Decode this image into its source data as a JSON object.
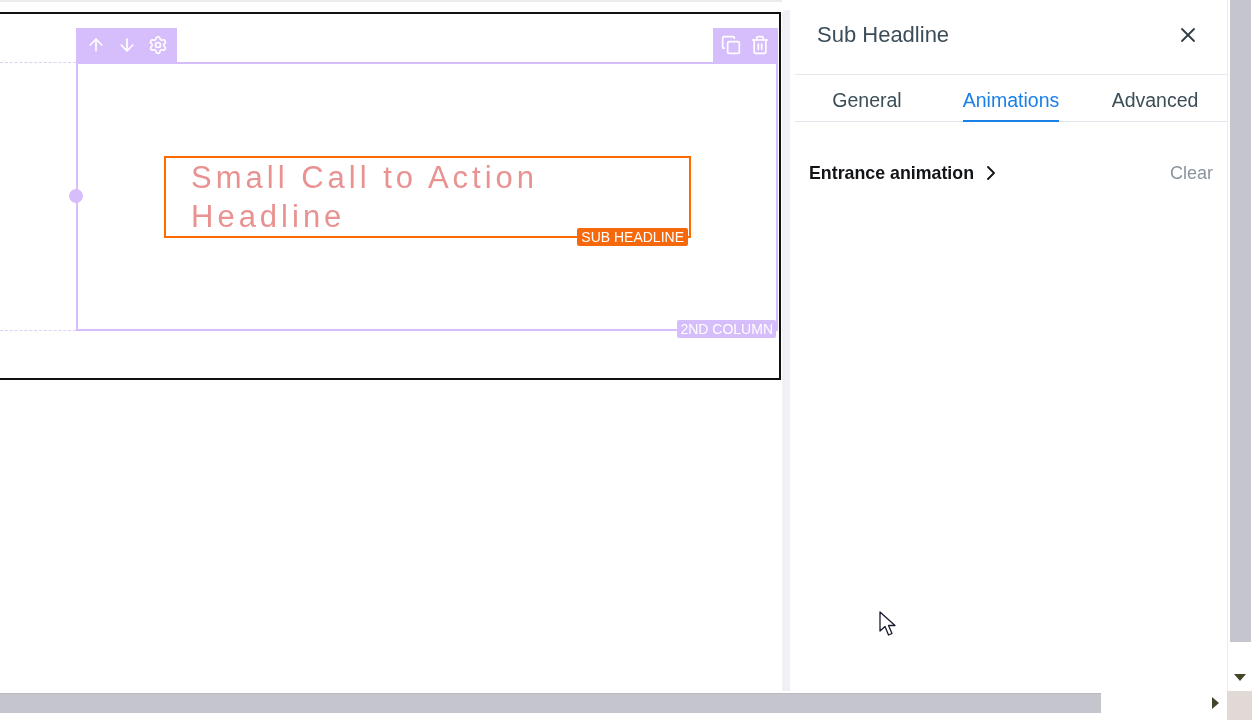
{
  "canvas": {
    "column": {
      "label": "2ND COLUMN"
    },
    "element": {
      "text": "Small Call to Action Headline",
      "label": "SUB HEADLINE"
    }
  },
  "panel": {
    "title": "Sub Headline",
    "tabs": [
      {
        "label": "General",
        "selected": false
      },
      {
        "label": "Animations",
        "selected": true
      },
      {
        "label": "Advanced",
        "selected": false
      }
    ],
    "settings": [
      {
        "label": "Entrance animation",
        "action": "Clear"
      }
    ]
  }
}
